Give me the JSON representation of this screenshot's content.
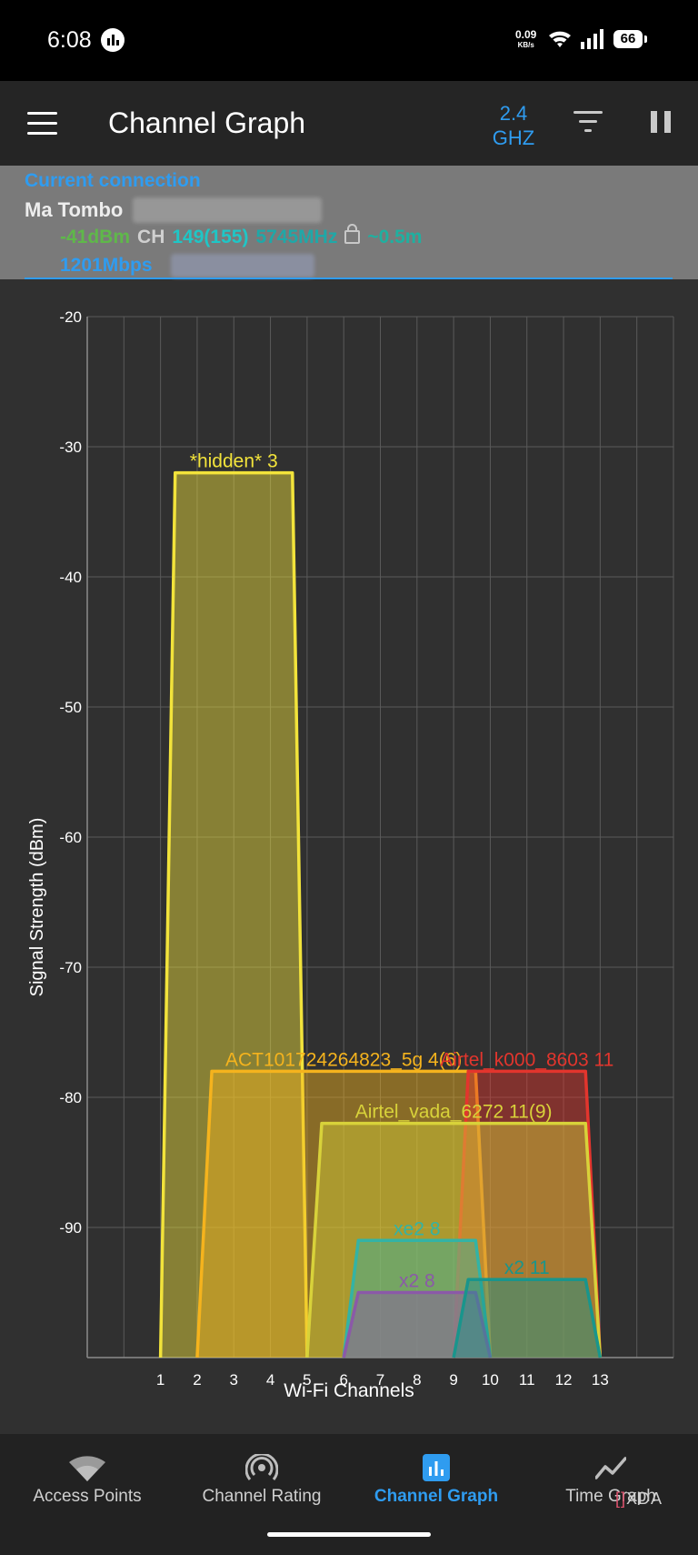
{
  "status_bar": {
    "time": "6:08",
    "net_speed": "0.09",
    "net_unit": "KB/s",
    "battery": "66"
  },
  "app_bar": {
    "title": "Channel Graph",
    "band_value": "2.4",
    "band_unit": "GHZ"
  },
  "connection": {
    "label": "Current connection",
    "ssid": "Ma Tombo",
    "signal": "-41dBm",
    "ch_label": "CH",
    "channel": "149(155)",
    "frequency": "5745MHz",
    "distance": "~0.5m",
    "link_speed": "1201Mbps"
  },
  "chart_data": {
    "type": "area",
    "xlabel": "Wi-Fi Channels",
    "ylabel": "Signal Strength (dBm)",
    "xlim": [
      -1,
      15
    ],
    "ylim": [
      -100,
      -20
    ],
    "x_ticks": [
      1,
      2,
      3,
      4,
      5,
      6,
      7,
      8,
      9,
      10,
      11,
      12,
      13
    ],
    "y_ticks": [
      -20,
      -30,
      -40,
      -50,
      -60,
      -70,
      -80,
      -90
    ],
    "grid": true,
    "series": [
      {
        "name": "*hidden* 3",
        "center": 3,
        "low": 1,
        "high": 5,
        "signal": -32,
        "color": "#f2e33b"
      },
      {
        "name": "ACT101724264823_5g 4(6)",
        "center": 6,
        "low": 2,
        "high": 10,
        "signal": -78,
        "color": "#f5b31d"
      },
      {
        "name": "Airtel_k000_8603 11",
        "center": 11,
        "low": 9,
        "high": 13,
        "signal": -78,
        "color": "#e3352d"
      },
      {
        "name": "Airtel_vada_6272 11(9)",
        "center": 9,
        "low": 5,
        "high": 13,
        "signal": -82,
        "color": "#d8d23a"
      },
      {
        "name": "xe2 8",
        "center": 8,
        "low": 6,
        "high": 10,
        "signal": -91,
        "color": "#33b3a5"
      },
      {
        "name": "x2 8",
        "center": 8,
        "low": 6,
        "high": 10,
        "signal": -95,
        "color": "#8b59a8"
      },
      {
        "name": "x2 11",
        "center": 11,
        "low": 9,
        "high": 13,
        "signal": -94,
        "color": "#19958c"
      }
    ]
  },
  "nav": {
    "items": [
      {
        "label": "Access Points",
        "icon": "wifi-icon"
      },
      {
        "label": "Channel Rating",
        "icon": "antenna-icon"
      },
      {
        "label": "Channel Graph",
        "icon": "bar-chart-icon"
      },
      {
        "label": "Time Graph",
        "icon": "line-graph-icon"
      }
    ],
    "active": "Channel Graph"
  },
  "watermark": {
    "bracket": "[]",
    "text": "XDA"
  }
}
